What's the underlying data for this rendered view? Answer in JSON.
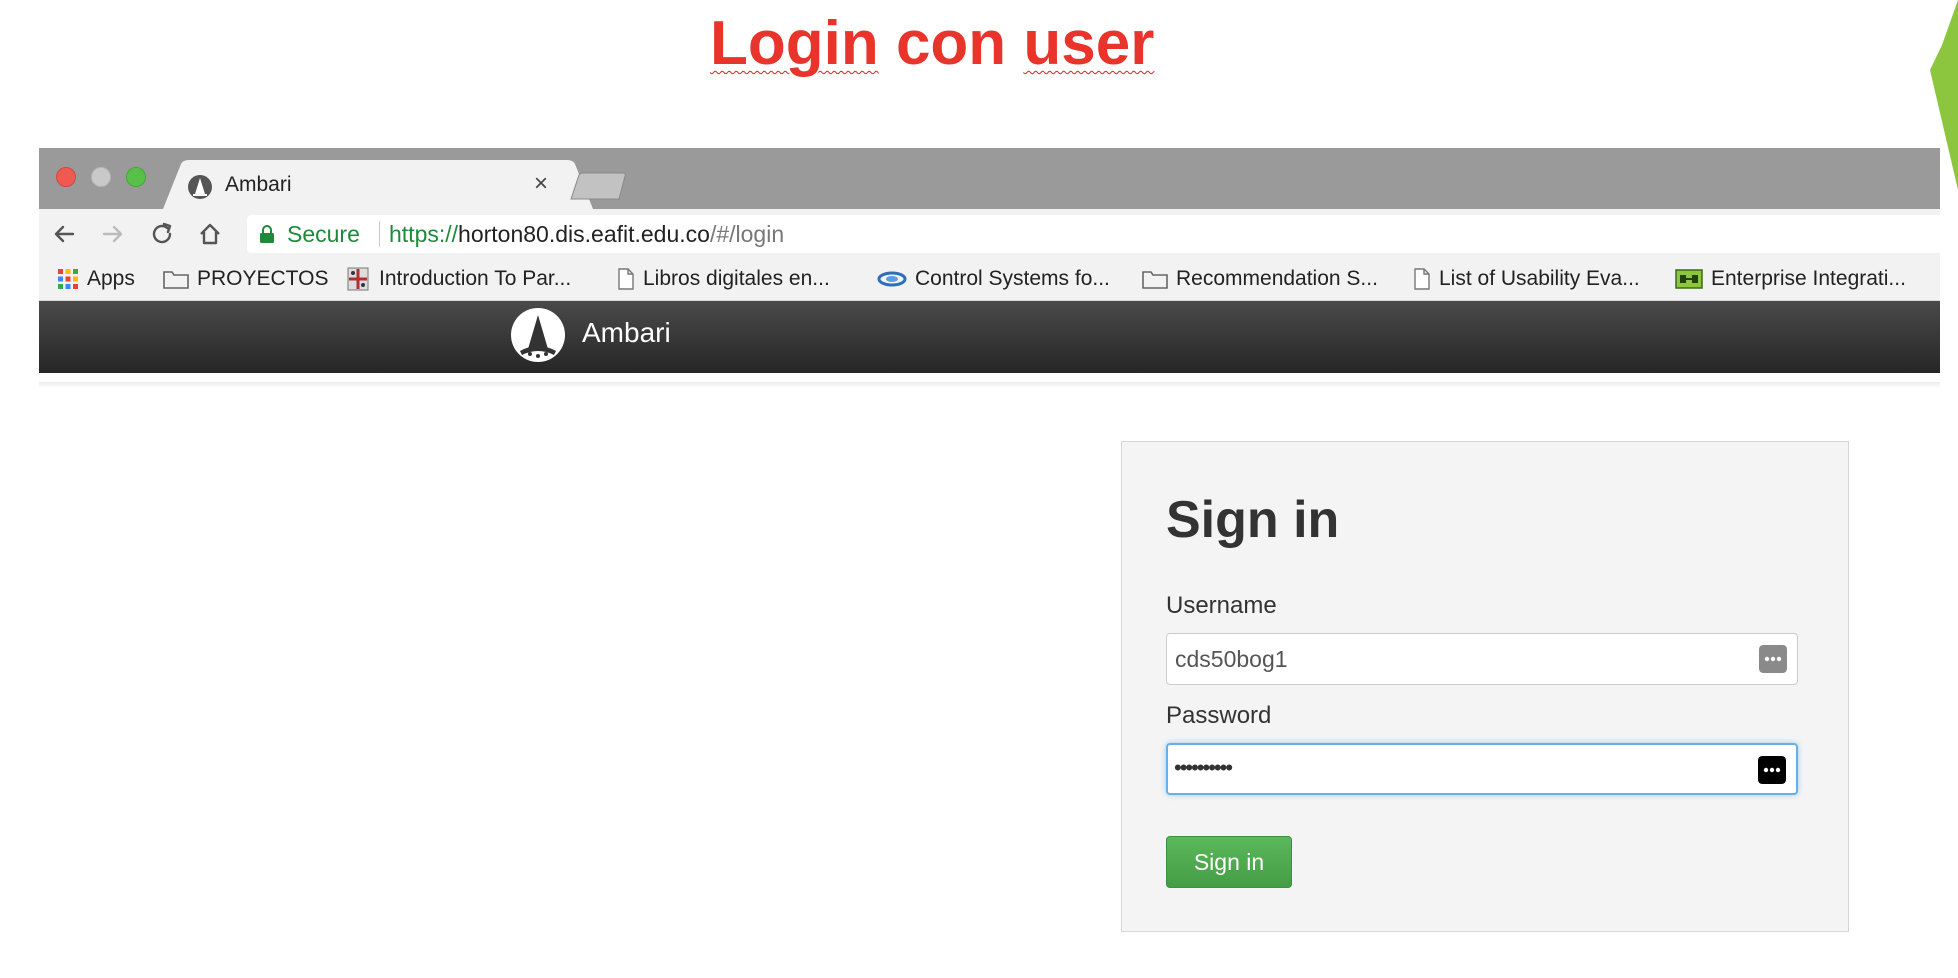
{
  "slide": {
    "title_word1": "Login",
    "title_word2": "con",
    "title_word3": "user"
  },
  "browser": {
    "tab": {
      "title": "Ambari",
      "close_glyph": "×",
      "favicon": "ambari-logo-icon"
    },
    "toolbar": {
      "back_icon": "arrow-left-icon",
      "forward_icon": "arrow-right-icon",
      "reload_icon": "reload-icon",
      "home_icon": "home-icon"
    },
    "address": {
      "secure_label": "Secure",
      "url_scheme": "https://",
      "url_host": "horton80.dis.eafit.edu.co",
      "url_path": "/#/login"
    },
    "bookmarks": [
      {
        "label": "Apps",
        "icon": "apps-grid-icon"
      },
      {
        "label": "PROYECTOS",
        "icon": "folder-icon"
      },
      {
        "label": "Introduction To Par...",
        "icon": "site-favicon"
      },
      {
        "label": "Libros digitales en...",
        "icon": "page-icon"
      },
      {
        "label": "Control Systems fo...",
        "icon": "site-favicon"
      },
      {
        "label": "Recommendation S...",
        "icon": "folder-icon"
      },
      {
        "label": "List of Usability Eva...",
        "icon": "page-icon"
      },
      {
        "label": "Enterprise Integrati...",
        "icon": "site-favicon"
      }
    ]
  },
  "app": {
    "brand": "Ambari",
    "signin": {
      "title": "Sign in",
      "username_label": "Username",
      "username_value": "cds50bog1",
      "password_label": "Password",
      "password_mask": "••••••••••",
      "button_label": "Sign in"
    }
  },
  "colors": {
    "title_red": "#e8342a",
    "secure_green": "#1e8a3a",
    "signin_green": "#5cb85c",
    "focus_blue": "#66afe9"
  }
}
